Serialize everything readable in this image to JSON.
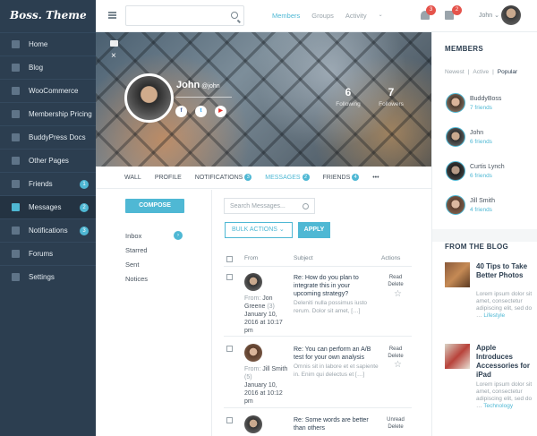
{
  "sidebar": {
    "logo": "Boss. Theme",
    "items": [
      {
        "label": "Home",
        "badge": ""
      },
      {
        "label": "Blog",
        "badge": ""
      },
      {
        "label": "WooCommerce",
        "badge": ""
      },
      {
        "label": "Membership Pricing",
        "badge": ""
      },
      {
        "label": "BuddyPress Docs",
        "badge": ""
      },
      {
        "label": "Other Pages",
        "badge": ""
      },
      {
        "label": "Friends",
        "badge": "1"
      },
      {
        "label": "Messages",
        "badge": "2"
      },
      {
        "label": "Notifications",
        "badge": "3"
      },
      {
        "label": "Forums",
        "badge": ""
      },
      {
        "label": "Settings",
        "badge": ""
      }
    ]
  },
  "topbar": {
    "nav": [
      "Members",
      "Groups",
      "Activity"
    ],
    "more": "⌄",
    "notifications_count": "3",
    "cart_count": "2",
    "user": "John ⌄"
  },
  "profile": {
    "name": "John",
    "handle": "@john",
    "social": [
      "f",
      "t",
      "▶"
    ],
    "following_count": "6",
    "following_label": "Following",
    "followers_count": "7",
    "followers_label": "Followers"
  },
  "tabs": {
    "wall": "WALL",
    "profile": "PROFILE",
    "notifications": "NOTIFICATIONS",
    "notifications_badge": "3",
    "messages": "MESSAGES",
    "messages_badge": "2",
    "friends": "FRIENDS",
    "friends_badge": "4",
    "more": "•••"
  },
  "messages_nav": {
    "compose": "COMPOSE",
    "inbox": "Inbox",
    "starred": "Starred",
    "sent": "Sent",
    "notices": "Notices"
  },
  "messages": {
    "search_placeholder": "Search Messages...",
    "bulk_actions": "BULK ACTIONS ⌄",
    "apply": "APPLY",
    "col_from": "From",
    "col_subject": "Subject",
    "col_actions": "Actions",
    "rows": [
      {
        "from_label": "From:",
        "name": "Jon Greene",
        "count": "(3)",
        "date": "January 10, 2016 at 10:17 pm",
        "subject": "Re: How do you plan to integrate this in your upcoming strategy?",
        "excerpt": "Deleniti nulla possimus iusto rerum. Dolor sit amet, […]",
        "action1": "Read",
        "action2": "Delete"
      },
      {
        "from_label": "From:",
        "name": "Jill Smith",
        "count": "(5)",
        "date": "January 10, 2016 at 10:12 pm",
        "subject": "Re: You can perform an A/B test for your own analysis",
        "excerpt": "Omnis sit in labore et et sapiente in. Enim qui delectus et […]",
        "action1": "Read",
        "action2": "Delete"
      },
      {
        "from_label": "",
        "name": "",
        "count": "",
        "date": "",
        "subject": "Re: Some words are better than others",
        "excerpt": "",
        "action1": "Unread",
        "action2": "Delete"
      }
    ]
  },
  "members_widget": {
    "title": "MEMBERS",
    "tabs": [
      "Newest",
      "Active",
      "Popular"
    ],
    "members": [
      {
        "name": "BuddyBoss",
        "friends": "7 friends"
      },
      {
        "name": "John",
        "friends": "6 friends"
      },
      {
        "name": "Curtis Lynch",
        "friends": "6 friends"
      },
      {
        "name": "Jill Smith",
        "friends": "4 friends"
      }
    ]
  },
  "blog_widget": {
    "title": "FROM THE BLOG",
    "posts": [
      {
        "title": "40 Tips to Take Better Photos",
        "excerpt": "Lorem ipsum dolor sit amet, consectetur adipiscing elit, sed do …",
        "tag": "Lifestyle"
      },
      {
        "title": "Apple Introduces Accessories for iPad",
        "excerpt": "Lorem ipsum dolor sit amet, consectetur adipiscing elit, sed do …",
        "tag": "Technology"
      }
    ]
  },
  "colors": {
    "accent": "#4fb8d4",
    "sidebar": "#2c3e50",
    "alert": "#e5534b"
  }
}
